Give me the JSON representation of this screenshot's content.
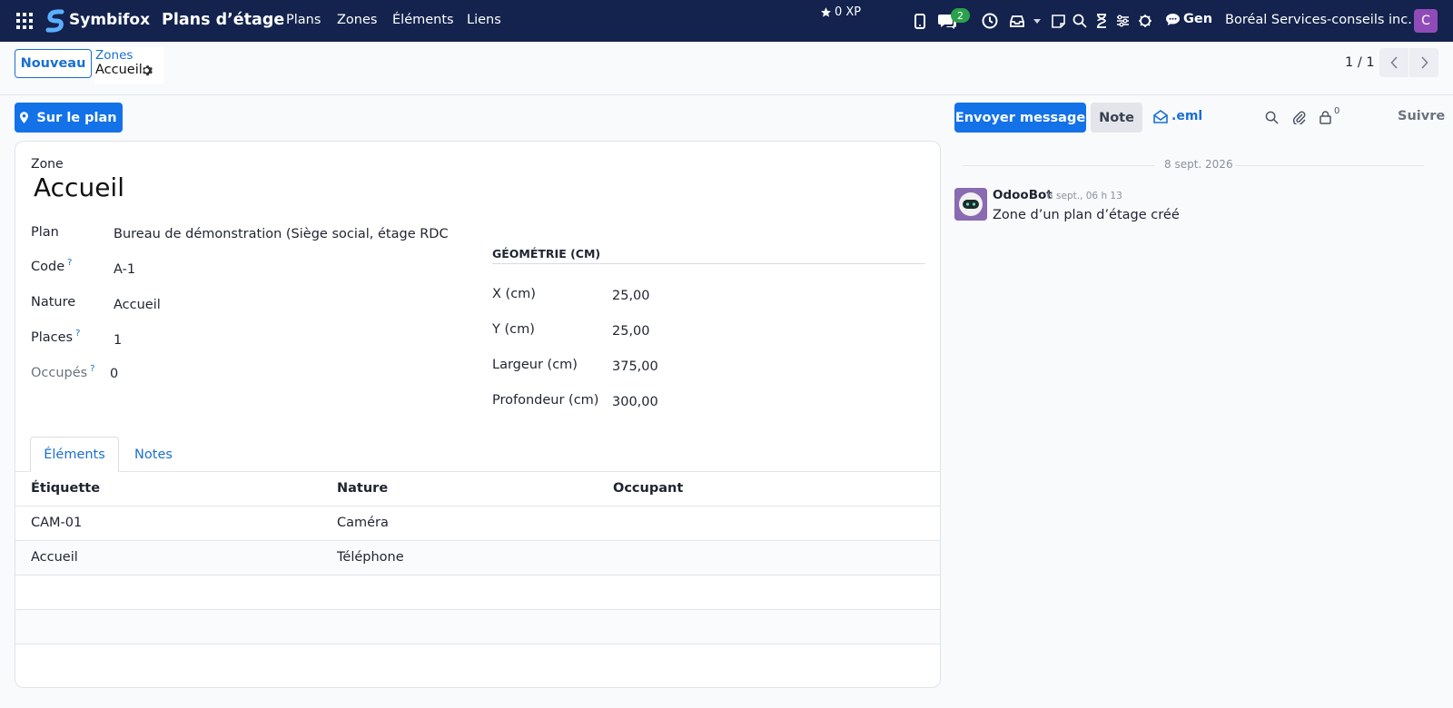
{
  "navbar": {
    "brand": "Symbifox",
    "app_title": "Plans d’étage",
    "menu": [
      "Plans",
      "Zones",
      "Éléments",
      "Liens"
    ],
    "xp": "0 XP",
    "messages_count": "2",
    "gen_label": "Gen",
    "company": "Boréal Services-conseils inc.",
    "avatar_letter": "C",
    "avatar_color": "#8f4cb8",
    "icons": [
      "apps-grid-icon",
      "star-icon",
      "phone-icon",
      "chat-icon",
      "clock-icon",
      "inbox-icon",
      "caret-down-icon",
      "note-icon",
      "search-icon",
      "hourglass-icon",
      "sliders-icon",
      "bug-icon",
      "comment-icon"
    ]
  },
  "control": {
    "new_button": "Nouveau",
    "breadcrumb_parent": "Zones",
    "breadcrumb_current": "Accueil",
    "pager": "1 / 1"
  },
  "actions": {
    "on_plan_button": "Sur le plan"
  },
  "form": {
    "header_label": "Zone",
    "title": "Accueil",
    "fields": {
      "plan": {
        "label": "Plan",
        "value": "Bureau de démonstration (Siège social, étage RDC"
      },
      "code": {
        "label": "Code",
        "value": "A-1"
      },
      "nature": {
        "label": "Nature",
        "value": "Accueil"
      },
      "places": {
        "label": "Places",
        "value": "1"
      },
      "occupied": {
        "label": "Occupés",
        "value": "0"
      }
    },
    "help_mark": "?",
    "geometry": {
      "title": "GÉOMÉTRIE (CM)",
      "x": {
        "label": "X (cm)",
        "value": "25,00"
      },
      "y": {
        "label": "Y (cm)",
        "value": "25,00"
      },
      "width": {
        "label": "Largeur (cm)",
        "value": "375,00"
      },
      "depth": {
        "label": "Profondeur (cm)",
        "value": "300,00"
      }
    },
    "tabs": [
      "Éléments",
      "Notes"
    ],
    "table": {
      "headers": [
        "Étiquette",
        "Nature",
        "Occupant"
      ],
      "rows": [
        {
          "label": "CAM-01",
          "nature": "Caméra",
          "occupant": ""
        },
        {
          "label": "Accueil",
          "nature": "Téléphone",
          "occupant": ""
        }
      ]
    }
  },
  "chatter": {
    "send_message": "Envoyer message",
    "note": "Note",
    "eml": ".eml",
    "followers_count": "0",
    "follow": "Suivre",
    "date_separator": "8 sept. 2026",
    "message": {
      "author": "OdooBot",
      "time": "8 sept., 06 h 13",
      "body": "Zone d’un plan d’étage créé"
    }
  },
  "colors": {
    "navbar_bg": "#13234d",
    "primary": "#1472e8",
    "link": "#1b6fd1",
    "badge": "#2aa14a"
  }
}
